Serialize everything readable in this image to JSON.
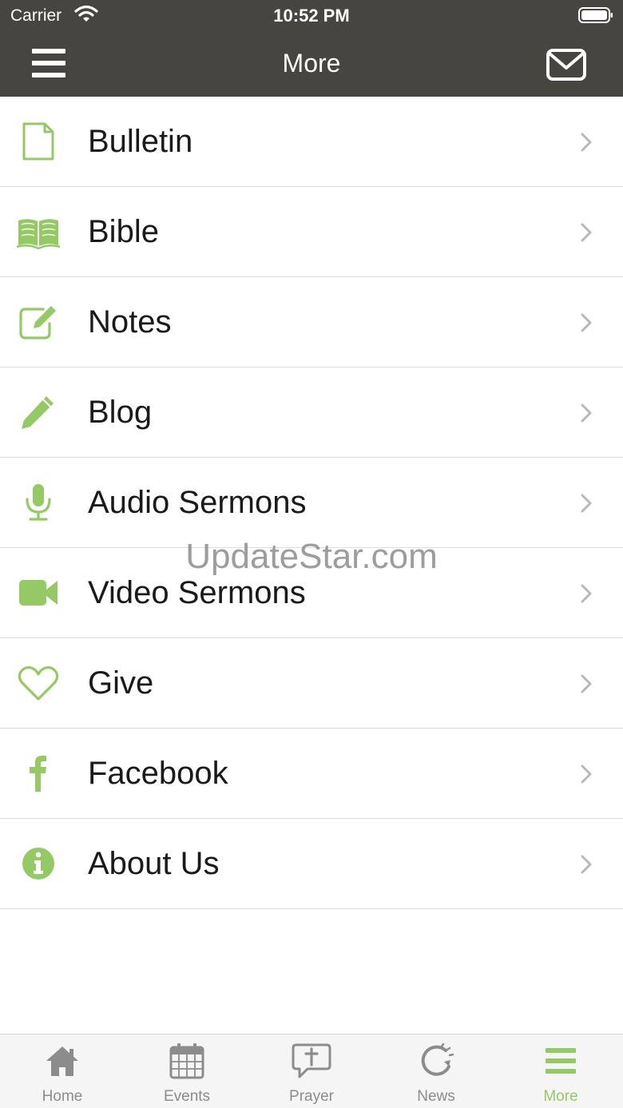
{
  "status_bar": {
    "carrier": "Carrier",
    "time": "10:52 PM"
  },
  "nav": {
    "title": "More",
    "left_icon": "hamburger-icon",
    "right_icon": "mail-icon"
  },
  "colors": {
    "header_bg": "#464541",
    "accent": "#94c965",
    "tab_inactive": "#8c8c8c"
  },
  "items": [
    {
      "label": "Bulletin",
      "icon": "document-icon"
    },
    {
      "label": "Bible",
      "icon": "open-book-icon"
    },
    {
      "label": "Notes",
      "icon": "edit-square-icon"
    },
    {
      "label": "Blog",
      "icon": "pencil-icon"
    },
    {
      "label": "Audio Sermons",
      "icon": "microphone-icon"
    },
    {
      "label": "Video Sermons",
      "icon": "video-camera-icon"
    },
    {
      "label": "Give",
      "icon": "heart-icon"
    },
    {
      "label": "Facebook",
      "icon": "facebook-icon"
    },
    {
      "label": "About Us",
      "icon": "info-icon"
    }
  ],
  "watermark": "UpdateStar.com",
  "tabs": [
    {
      "label": "Home",
      "icon": "home-icon",
      "active": false
    },
    {
      "label": "Events",
      "icon": "calendar-icon",
      "active": false
    },
    {
      "label": "Prayer",
      "icon": "prayer-icon",
      "active": false
    },
    {
      "label": "News",
      "icon": "refresh-icon",
      "active": false
    },
    {
      "label": "More",
      "icon": "hamburger-icon",
      "active": true
    }
  ]
}
